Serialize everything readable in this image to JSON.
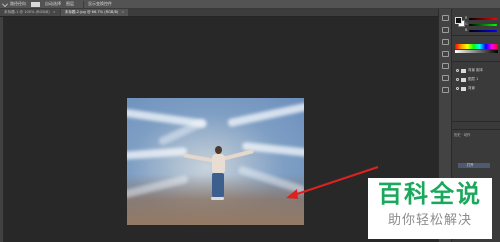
{
  "options_bar": {
    "tool_name": "路径径向",
    "options": [
      "自动选择",
      "图层",
      "显示变换控件"
    ],
    "align_icons_label": ""
  },
  "tabs": [
    {
      "label": "未标题-1 @ 100% (RGB/8)",
      "active": false
    },
    {
      "label": "未标题-2.jpg @ 66.7% (RGB/8)",
      "active": true
    }
  ],
  "color_panel": {
    "r": "R",
    "g": "G",
    "b": "B"
  },
  "layers": [
    {
      "name": "背景 副本",
      "icon": "folder-icon"
    },
    {
      "name": "图层 1",
      "icon": "image-thumb"
    },
    {
      "name": "背景",
      "icon": "image-thumb"
    }
  ],
  "history_panel": {
    "tabs": "历史 · 动作",
    "row": "打开"
  },
  "watermark": {
    "title": "百科全说",
    "subtitle": "助你轻松解决"
  },
  "colors": {
    "watermark_green": "#1aa85c",
    "arrow_red": "#e02020"
  }
}
